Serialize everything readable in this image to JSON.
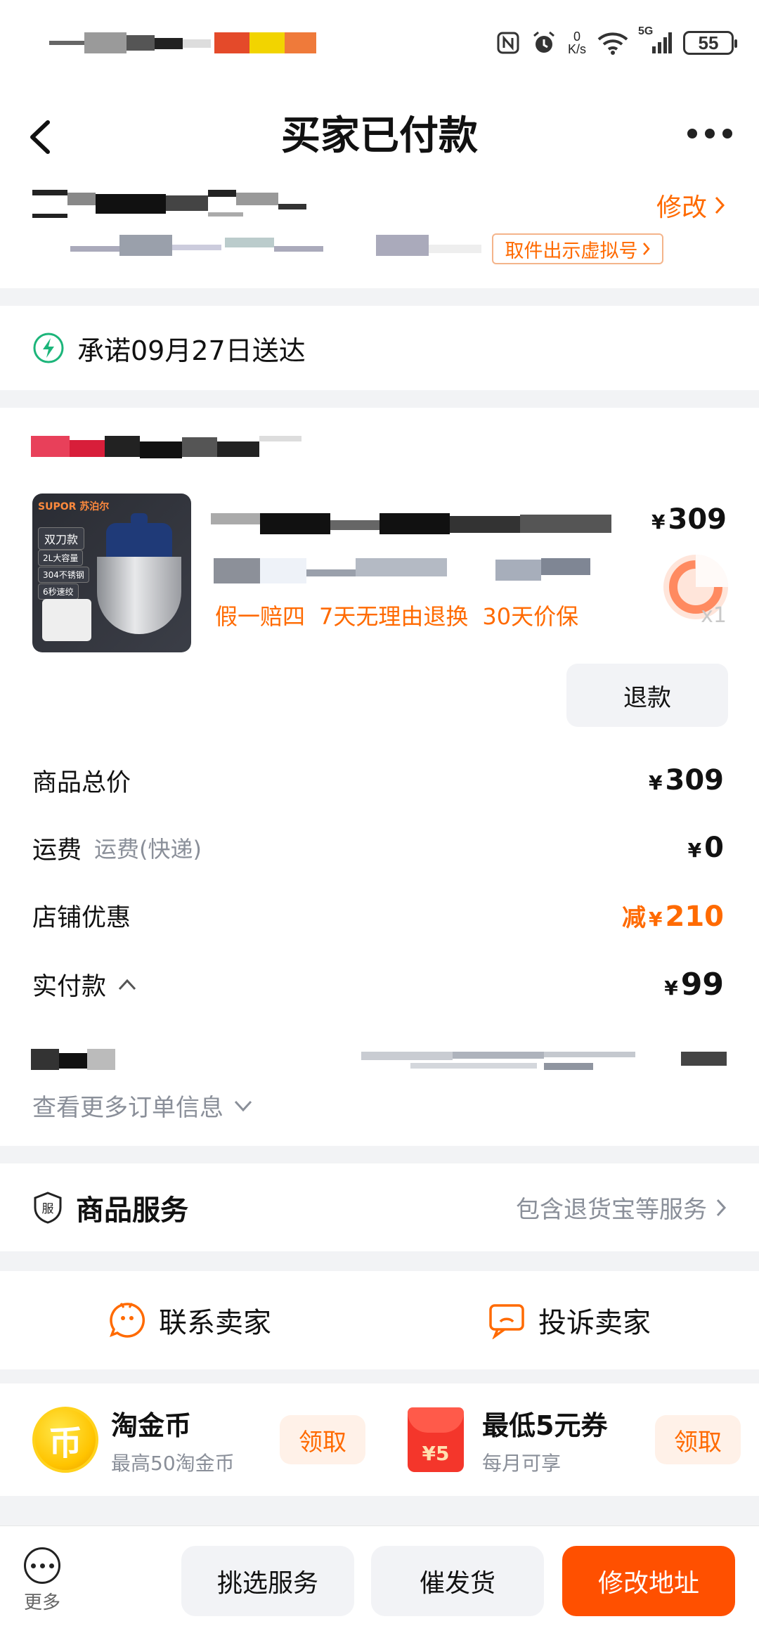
{
  "status_bar": {
    "net_speed_value": "0",
    "net_speed_unit": "K/s",
    "signal_label": "5G",
    "battery": "55",
    "icons": [
      "nfc-icon",
      "alarm-icon",
      "wifi-icon",
      "signal-icon",
      "battery-icon"
    ]
  },
  "nav": {
    "title": "买家已付款",
    "back_icon": "chevron-left-icon",
    "more_icon": "more-dots-icon"
  },
  "address": {
    "edit_label": "修改",
    "pickup_label": "取件出示虚拟号"
  },
  "delivery": {
    "promise_text": "承诺09月27日送达",
    "icon": "lightning-icon"
  },
  "order": {
    "product": {
      "thumb_brand": "SUPOR 苏泊尔",
      "thumb_tags": [
        "双刀款",
        "2L大容量",
        "304不锈钢",
        "6秒速绞"
      ],
      "price_symbol": "¥",
      "price": "309",
      "quantity": "x1",
      "guarantees": [
        "假一赔四",
        "7天无理由退换",
        "30天价保"
      ]
    },
    "refund_label": "退款",
    "summary": {
      "total_label": "商品总价",
      "total_symbol": "¥",
      "total_value": "309",
      "shipping_label": "运费",
      "shipping_sub": "运费(快递)",
      "shipping_symbol": "¥",
      "shipping_value": "0",
      "discount_label": "店铺优惠",
      "discount_prefix": "减",
      "discount_symbol": "¥",
      "discount_value": "210",
      "paid_label": "实付款",
      "paid_symbol": "¥",
      "paid_value": "99"
    },
    "more_info_label": "查看更多订单信息"
  },
  "service": {
    "title": "商品服务",
    "icon_text": "服",
    "desc": "包含退货宝等服务"
  },
  "contact": {
    "contact_seller": "联系卖家",
    "complain_seller": "投诉卖家"
  },
  "promo": {
    "coin_symbol": "币",
    "coin_title": "淘金币",
    "coin_sub": "最高50淘金币",
    "coin_btn": "领取",
    "coupon_symbol": "¥5",
    "coupon_title": "最低5元券",
    "coupon_sub": "每月可享",
    "coupon_btn": "领取"
  },
  "bottom_bar": {
    "more_label": "更多",
    "select_service": "挑选服务",
    "urge_shipping": "催发货",
    "modify_address": "修改地址"
  },
  "colors": {
    "accent": "#ff6a00",
    "primary_button": "#ff5000",
    "secondary_text": "#8a8f99",
    "background": "#f2f3f5",
    "delivery_green": "#1cb57a"
  }
}
